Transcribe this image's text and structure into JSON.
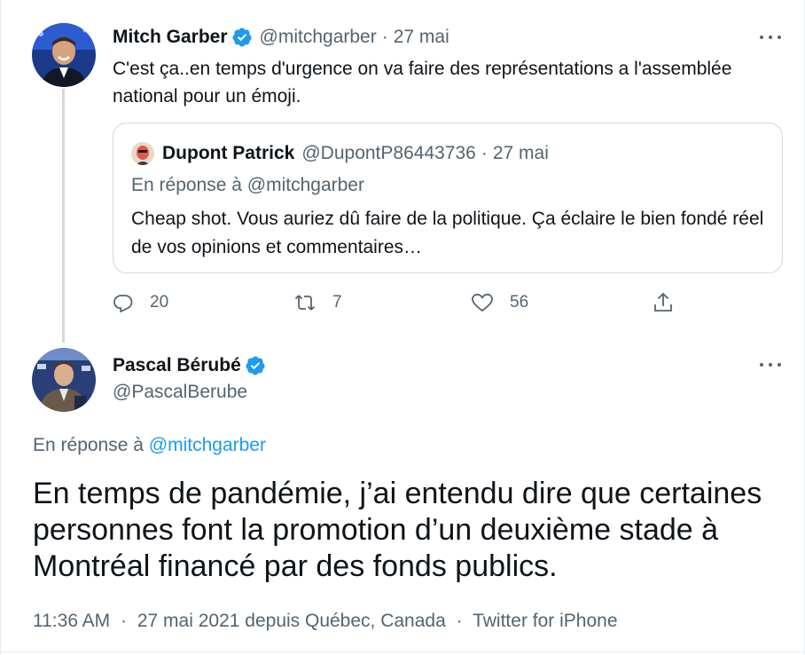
{
  "tweet1": {
    "author_name": "Mitch Garber",
    "handle": "@mitchgarber",
    "separator": "·",
    "date": "27 mai",
    "text": "C'est ça..en temps d'urgence on va faire des représentations a l'assemblée national pour un émoji.",
    "quoted": {
      "author_name": "Dupont Patrick",
      "handle": "@DupontP86443736",
      "separator": "·",
      "date": "27 mai",
      "reply_prefix": "En réponse à",
      "reply_to": "@mitchgarber",
      "text": "Cheap shot. Vous auriez dû faire de la politique. Ça éclaire le bien fondé réel de vos opinions et commentaires…"
    },
    "actions": {
      "reply_count": "20",
      "retweet_count": "7",
      "like_count": "56"
    }
  },
  "tweet2": {
    "author_name": "Pascal Bérubé",
    "handle": "@PascalBerube",
    "reply_prefix": "En réponse à",
    "reply_to": "@mitchgarber",
    "text": "En temps de pandémie, j’ai entendu dire que certaines personnes font la promotion d’un deuxième stade à Montréal financé par des fonds publics.",
    "time": "11:36 AM",
    "separator": "·",
    "date_location": "27 mai 2021 depuis Québec, Canada",
    "source": "Twitter for iPhone"
  },
  "icons": {
    "verified": "verified-badge-icon",
    "more": "more-dots-icon",
    "reply": "reply-icon",
    "retweet": "retweet-icon",
    "like": "heart-icon",
    "share": "share-icon"
  },
  "colors": {
    "verified_blue": "#1d9bf0",
    "secondary_text": "#536471",
    "primary_text": "#0f1419",
    "link": "#1d9bf0",
    "border": "#cfd9de"
  }
}
